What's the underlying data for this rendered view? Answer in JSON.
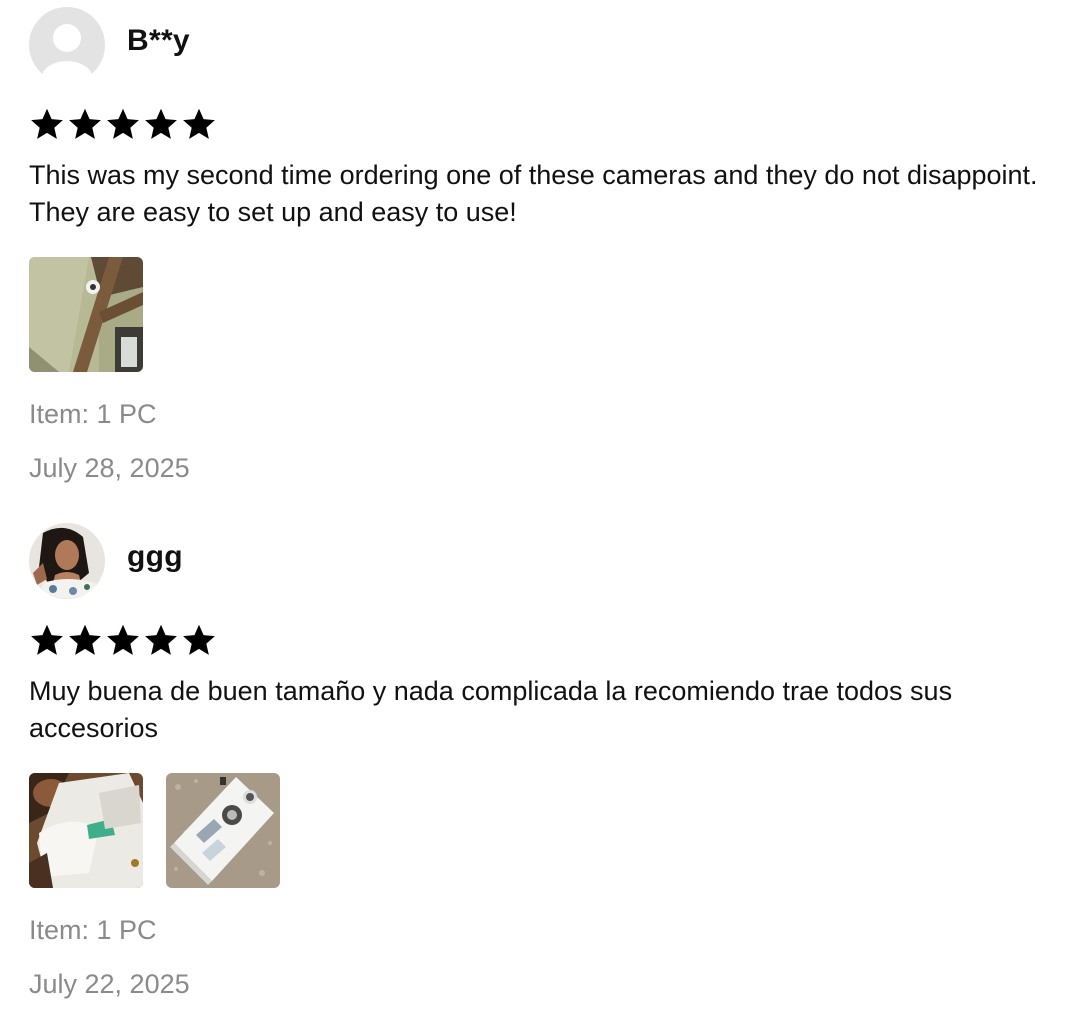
{
  "reviews": [
    {
      "reviewer": "B**y",
      "avatar": "default-avatar-icon",
      "rating": 5,
      "text": "This was my second time ordering one of these cameras and they do not disappoint. They are easy to set up and easy to use!",
      "item": "Item: 1 PC",
      "date": "July 28, 2025"
    },
    {
      "reviewer": "ggg",
      "avatar": "user-photo-avatar",
      "rating": 5,
      "text": "Muy buena de buen tamaño y nada complicada la recomiendo trae todos sus accesorios",
      "item": "Item: 1 PC",
      "date": "July 22, 2025"
    }
  ],
  "colors": {
    "text": "#111111",
    "muted": "#8a8a8a",
    "star": "#000000",
    "avatar_bg": "#e3e3e3"
  }
}
